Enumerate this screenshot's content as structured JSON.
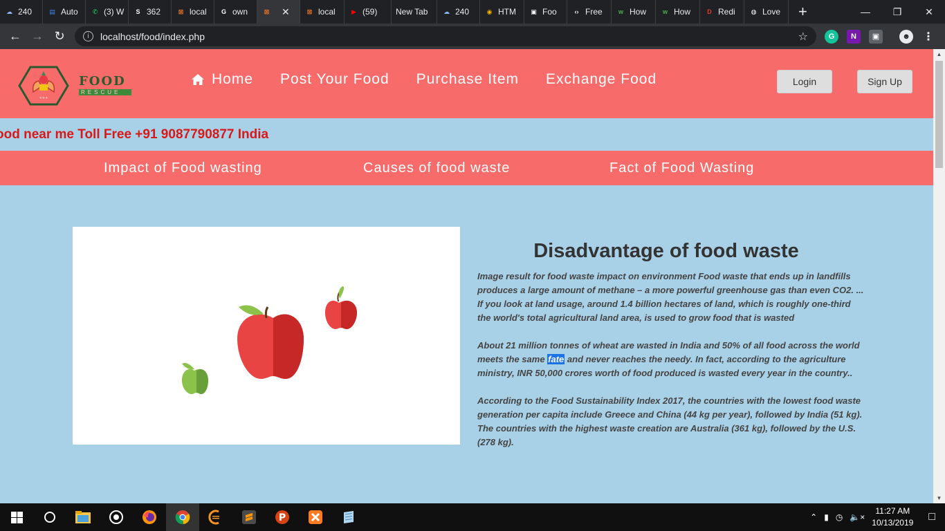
{
  "browser": {
    "tabs": [
      {
        "label": "240",
        "fav": "cloud-icon",
        "color": "#8ab4f8"
      },
      {
        "label": "Auto",
        "fav": "docs-icon",
        "color": "#4285f4"
      },
      {
        "label": "(3) W",
        "fav": "whatsapp-icon",
        "color": "#25d366"
      },
      {
        "label": "362",
        "fav": "s-icon",
        "color": "#ffffff"
      },
      {
        "label": "local",
        "fav": "xampp-icon",
        "color": "#fb7a24"
      },
      {
        "label": "own",
        "fav": "google-icon",
        "color": "#ffffff"
      },
      {
        "label": "",
        "fav": "xampp-icon",
        "color": "#fb7a24",
        "active": true
      },
      {
        "label": "local",
        "fav": "xampp-icon",
        "color": "#fb7a24"
      },
      {
        "label": "(59)",
        "fav": "youtube-icon",
        "color": "#ff0000"
      },
      {
        "label": "New Tab",
        "fav": "",
        "color": ""
      },
      {
        "label": "240",
        "fav": "cloud-icon",
        "color": "#8ab4f8"
      },
      {
        "label": "HTM",
        "fav": "html-icon",
        "color": "#f4b400"
      },
      {
        "label": "Foo",
        "fav": "box-icon",
        "color": "#ffffff"
      },
      {
        "label": "Free",
        "fav": "code-icon",
        "color": "#ffffff"
      },
      {
        "label": "How",
        "fav": "w3-icon",
        "color": "#4caf50"
      },
      {
        "label": "How",
        "fav": "w3-icon",
        "color": "#4caf50"
      },
      {
        "label": "Redi",
        "fav": "dte-icon",
        "color": "#e53935"
      },
      {
        "label": "Love",
        "fav": "globe-icon",
        "color": "#ffffff"
      }
    ],
    "url": "localhost/food/index.php"
  },
  "header": {
    "brand_top": "FOOD",
    "brand_bottom": "RESCUE",
    "nav": [
      {
        "label": "Home",
        "icon": "home-icon"
      },
      {
        "label": "Post Your Food"
      },
      {
        "label": "Purchase Item"
      },
      {
        "label": "Exchange Food"
      }
    ],
    "login_label": "Login",
    "signup_label": "Sign Up"
  },
  "ticker": "ood near me Toll Free +91 9087790877 India",
  "subnav": [
    "Impact of Food wasting",
    "Causes of food waste",
    "Fact of Food Wasting"
  ],
  "article": {
    "title": "Disadvantage of food waste",
    "p1": "Image result for food waste impact on environment Food waste that ends up in landfills produces a large amount of methane – a more powerful greenhouse gas than even CO2. ... If you look at land usage, around 1.4 billion hectares of land, which is roughly one-third the world's total agricultural land area, is used to grow food that is wasted",
    "p2_before": "About 21 million tonnes of wheat are wasted in India and 50% of all food across the world meets the same ",
    "p2_highlight": "fate",
    "p2_after": " and never reaches the needy. In fact, according to the agriculture ministry, INR 50,000 crores worth of food produced is wasted every year in the country..",
    "p3": "According to the Food Sustainability Index 2017, the countries with the lowest food waste generation per capita include Greece and China (44 kg per year), followed by India (51 kg). The countries with the highest waste creation are Australia (361 kg), followed by the U.S. (278 kg)."
  },
  "taskbar": {
    "time": "11:27 AM",
    "date": "10/13/2019"
  },
  "colors": {
    "header": "#f76b6b",
    "page_bg": "#a8d0e6",
    "ticker": "#d81919"
  }
}
